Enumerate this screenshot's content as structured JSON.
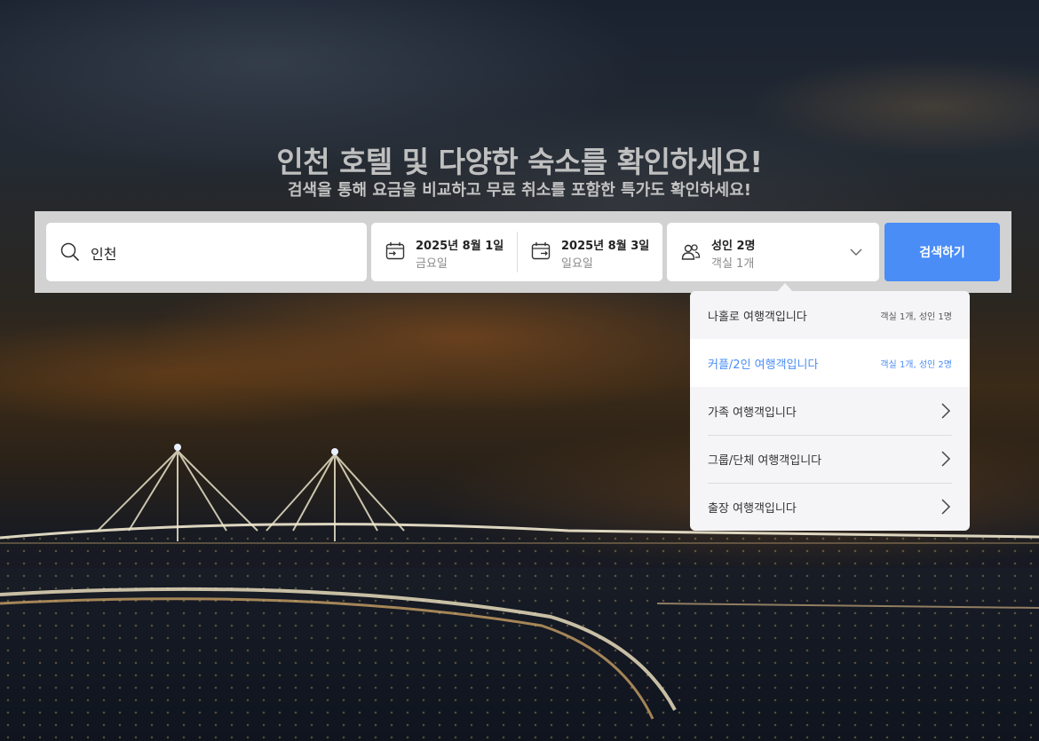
{
  "hero": {
    "title": "인천 호텔 및 다양한 숙소를 확인하세요!",
    "subtitle": "검색을 통해 요금을 비교하고 무료 취소를 포함한 특가도 확인하세요!"
  },
  "search": {
    "destination": "인천",
    "checkin": {
      "date": "2025년 8월 1일",
      "weekday": "금요일"
    },
    "checkout": {
      "date": "2025년 8월 3일",
      "weekday": "일요일"
    },
    "guests": {
      "primary": "성인 2명",
      "secondary": "객실 1개"
    },
    "button_label": "검색하기"
  },
  "traveler_options": [
    {
      "label": "나홀로 여행객입니다",
      "meta": "객실 1개, 성인 1명",
      "selected": false
    },
    {
      "label": "커플/2인 여행객입니다",
      "meta": "객실 1개, 성인 2명",
      "selected": true
    },
    {
      "label": "가족 여행객입니다",
      "meta": "",
      "selected": false
    },
    {
      "label": "그룹/단체 여행객입니다",
      "meta": "",
      "selected": false
    },
    {
      "label": "출장 여행객입니다",
      "meta": "",
      "selected": false
    }
  ],
  "icons": {
    "destination": "search-icon",
    "checkin": "calendar-checkin-icon",
    "checkout": "calendar-checkout-icon",
    "guests": "people-icon",
    "guests_toggle": "chevron-down-icon",
    "option_more": "chevron-right-icon"
  },
  "colors": {
    "accent": "#4a8df6",
    "search_bar_bg": "#d2d2d2",
    "dropdown_bg": "#f5f5f7"
  }
}
